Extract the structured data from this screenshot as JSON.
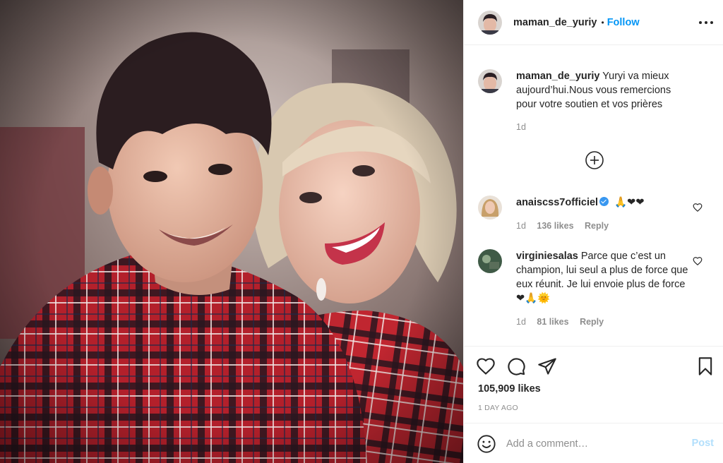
{
  "post": {
    "author": "maman_de_yuriy",
    "separator": "•",
    "follow_label": "Follow",
    "image_alt": "Photo of a boy and a woman in red tartan shirts, heads leaning together"
  },
  "caption": {
    "username": "maman_de_yuriy",
    "text": "Yuryi va mieux aujourd’hui.Nous vous remercions pour votre soutien et vos prières",
    "time": "1d"
  },
  "comments": [
    {
      "username": "anaiscss7officiel",
      "verified": true,
      "text": "🙏❤❤",
      "time": "1d",
      "likes": "136 likes",
      "reply_label": "Reply"
    },
    {
      "username": "virginiesalas",
      "verified": false,
      "text": "Parce que c’est un champion, lui seul a plus de force que eux réunit. Je lui envoie plus de force ❤🙏🌞",
      "time": "1d",
      "likes": "81 likes",
      "reply_label": "Reply"
    }
  ],
  "stats": {
    "likes": "105,909 likes",
    "posted": "1 DAY AGO"
  },
  "composer": {
    "placeholder": "Add a comment…",
    "post_label": "Post"
  },
  "icons": {
    "more": "more-horizontal-icon",
    "load_more": "plus-circle-icon",
    "like": "heart-icon",
    "comment": "comment-bubble-icon",
    "share": "paper-plane-icon",
    "save": "bookmark-icon",
    "emoji": "smiley-icon"
  },
  "colors": {
    "link": "#0095f6",
    "post_disabled": "#b2dffc",
    "muted": "#8e8e8e",
    "heart_red": "#e0245e"
  }
}
